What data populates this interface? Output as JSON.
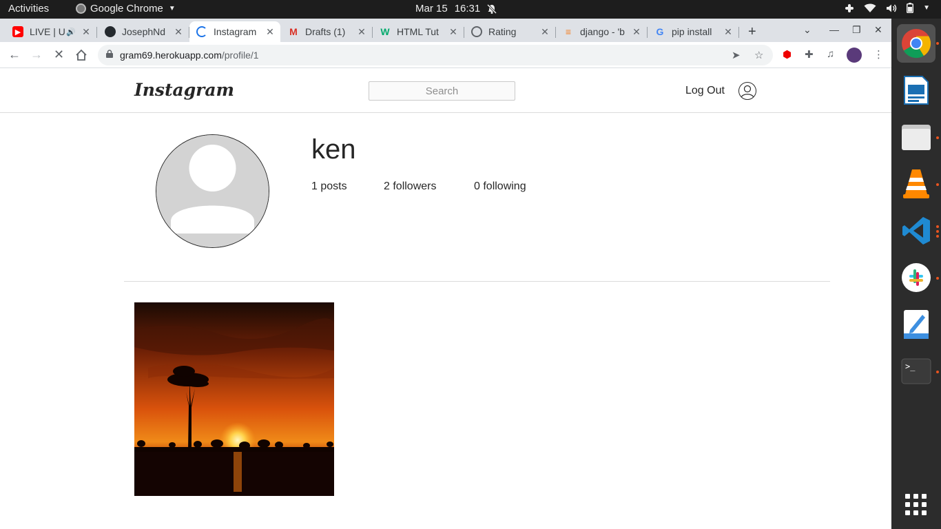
{
  "system_bar": {
    "activities": "Activities",
    "app_name": "Google Chrome",
    "date": "Mar 15",
    "time": "16:31"
  },
  "tabs": [
    {
      "title": "LIVE | U",
      "favicon": "youtube-icon",
      "color": "#ff0000"
    },
    {
      "title": "JosephNd",
      "favicon": "github-icon",
      "color": "#24292e"
    },
    {
      "title": "Instagram",
      "favicon": "loading-spinner-icon",
      "color": "#1a73e8",
      "active": true
    },
    {
      "title": "Drafts (1)",
      "favicon": "gmail-icon",
      "color": "#d93025"
    },
    {
      "title": "HTML Tut",
      "favicon": "w3schools-icon",
      "color": "#04aa6d"
    },
    {
      "title": "Rating",
      "favicon": "globe-icon",
      "color": "#5f6368"
    },
    {
      "title": "django - 'b",
      "favicon": "stackoverflow-icon",
      "color": "#f48024"
    },
    {
      "title": "pip install",
      "favicon": "google-icon",
      "color": "#4285f4"
    }
  ],
  "address_bar": {
    "host": "gram69.herokuapp.com",
    "path": "/profile/1"
  },
  "site": {
    "logo": "Instagram",
    "search_placeholder": "Search",
    "logout": "Log Out"
  },
  "profile": {
    "username": "ken",
    "posts": "1 posts",
    "followers": "2 followers",
    "following": "0 following"
  },
  "dock": [
    "chrome-icon",
    "libreoffice-impress-icon",
    "files-icon",
    "vlc-icon",
    "vscode-icon",
    "slack-icon",
    "text-editor-icon",
    "terminal-icon",
    "show-apps-icon"
  ]
}
